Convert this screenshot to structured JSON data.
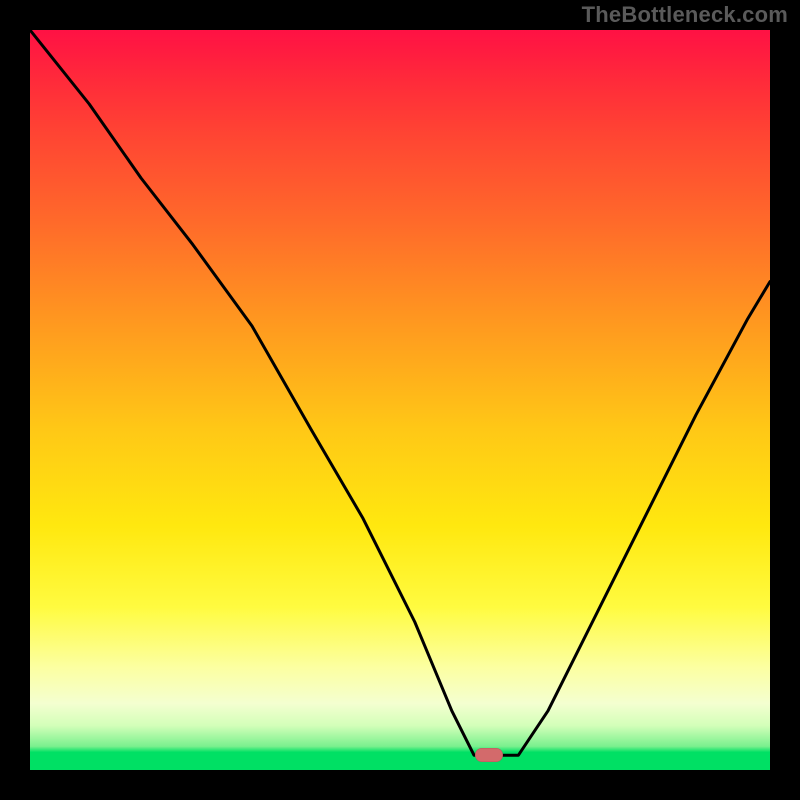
{
  "watermark": {
    "text": "TheBottleneck.com"
  },
  "colors": {
    "background": "#000000",
    "curve": "#000000",
    "marker": "#d36a6b",
    "gradient_stops": [
      "#ff1144",
      "#ff2b3a",
      "#ff4433",
      "#ff6a2a",
      "#ff9a1f",
      "#ffc816",
      "#ffe80f",
      "#fffb40",
      "#fcffa0",
      "#f4ffd0",
      "#d3ffb9",
      "#7af08e",
      "#00e064"
    ]
  },
  "chart_data": {
    "type": "line",
    "title": "",
    "xlabel": "",
    "ylabel": "",
    "xlim": [
      0,
      100
    ],
    "ylim": [
      0,
      100
    ],
    "grid": false,
    "legend": false,
    "marker": {
      "x": 62,
      "y": 2,
      "shape": "rounded-rect"
    },
    "series": [
      {
        "name": "bottleneck-curve",
        "x": [
          0,
          8,
          15,
          22,
          30,
          38,
          45,
          52,
          57,
          60,
          63,
          66,
          70,
          75,
          82,
          90,
          97,
          100
        ],
        "values": [
          100,
          90,
          80,
          71,
          60,
          46,
          34,
          20,
          8,
          2,
          2,
          2,
          8,
          18,
          32,
          48,
          61,
          66
        ]
      }
    ],
    "annotations": []
  }
}
